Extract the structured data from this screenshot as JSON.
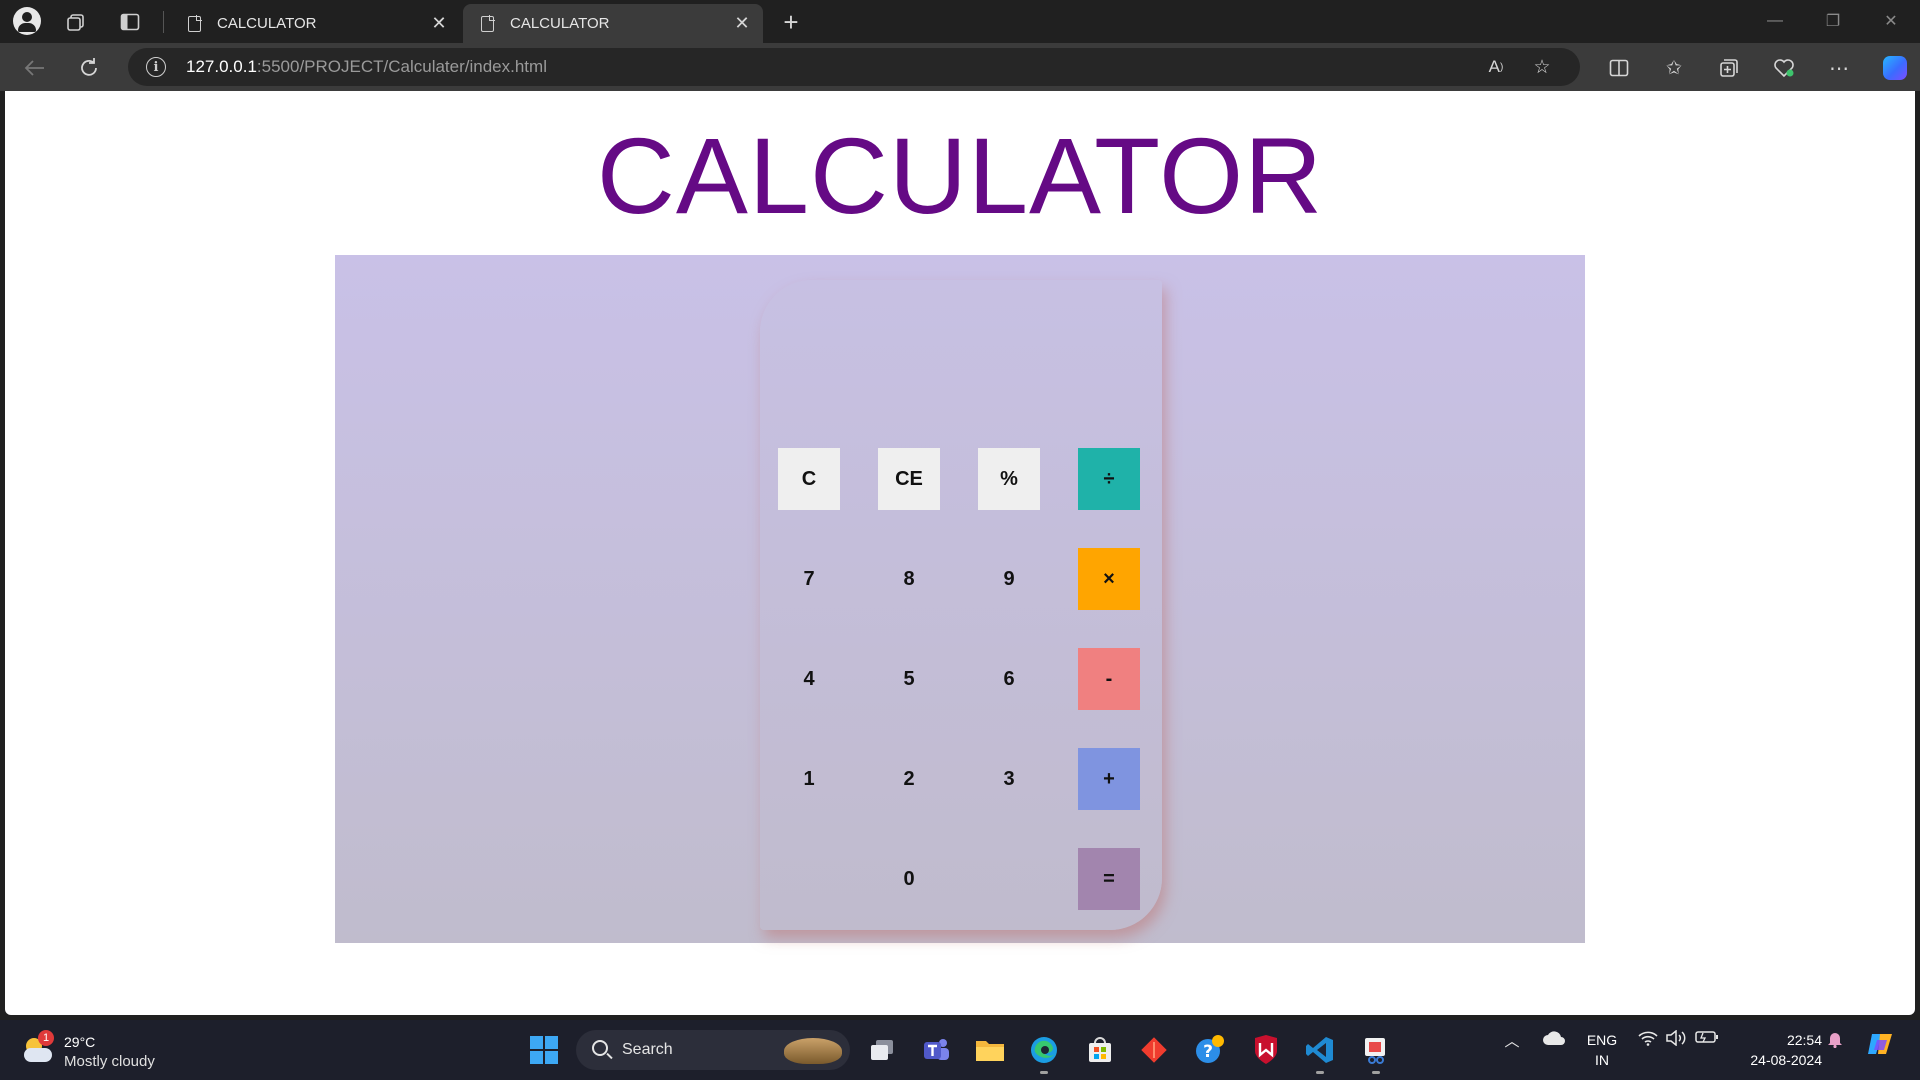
{
  "browser": {
    "tabs": [
      {
        "title": "CALCULATOR",
        "active": false
      },
      {
        "title": "CALCULATOR",
        "active": true
      }
    ],
    "new_tab_symbol": "+",
    "close_symbol": "✕",
    "address": {
      "host": "127.0.0.1",
      "rest": ":5500/PROJECT/Calculater/index.html"
    },
    "window_controls": {
      "minimize": "—",
      "restore": "❐",
      "close": "✕"
    }
  },
  "page": {
    "title": "CALCULATOR",
    "display_value": "",
    "keys": [
      {
        "label": "C",
        "style": "light"
      },
      {
        "label": "CE",
        "style": "light"
      },
      {
        "label": "%",
        "style": "light"
      },
      {
        "label": "÷",
        "style": "div"
      },
      {
        "label": "7",
        "style": "plain"
      },
      {
        "label": "8",
        "style": "plain"
      },
      {
        "label": "9",
        "style": "plain"
      },
      {
        "label": "×",
        "style": "mul"
      },
      {
        "label": "4",
        "style": "plain"
      },
      {
        "label": "5",
        "style": "plain"
      },
      {
        "label": "6",
        "style": "plain"
      },
      {
        "label": "-",
        "style": "sub"
      },
      {
        "label": "1",
        "style": "plain"
      },
      {
        "label": "2",
        "style": "plain"
      },
      {
        "label": "3",
        "style": "plain"
      },
      {
        "label": "+",
        "style": "add"
      },
      {
        "label": "0",
        "style": "plain"
      },
      {
        "label": "=",
        "style": "eq"
      }
    ],
    "colors": {
      "title": "#650a85",
      "divide": "#1fb2a9",
      "multiply": "#ffa500",
      "subtract": "#f08080",
      "add": "#7f94e0",
      "equals": "#a285ae"
    }
  },
  "taskbar": {
    "weather": {
      "badge": "1",
      "temp": "29°C",
      "condition": "Mostly cloudy"
    },
    "search_label": "Search",
    "language": {
      "line1": "ENG",
      "line2": "IN"
    },
    "clock": {
      "time": "22:54",
      "date": "24-08-2024"
    }
  }
}
